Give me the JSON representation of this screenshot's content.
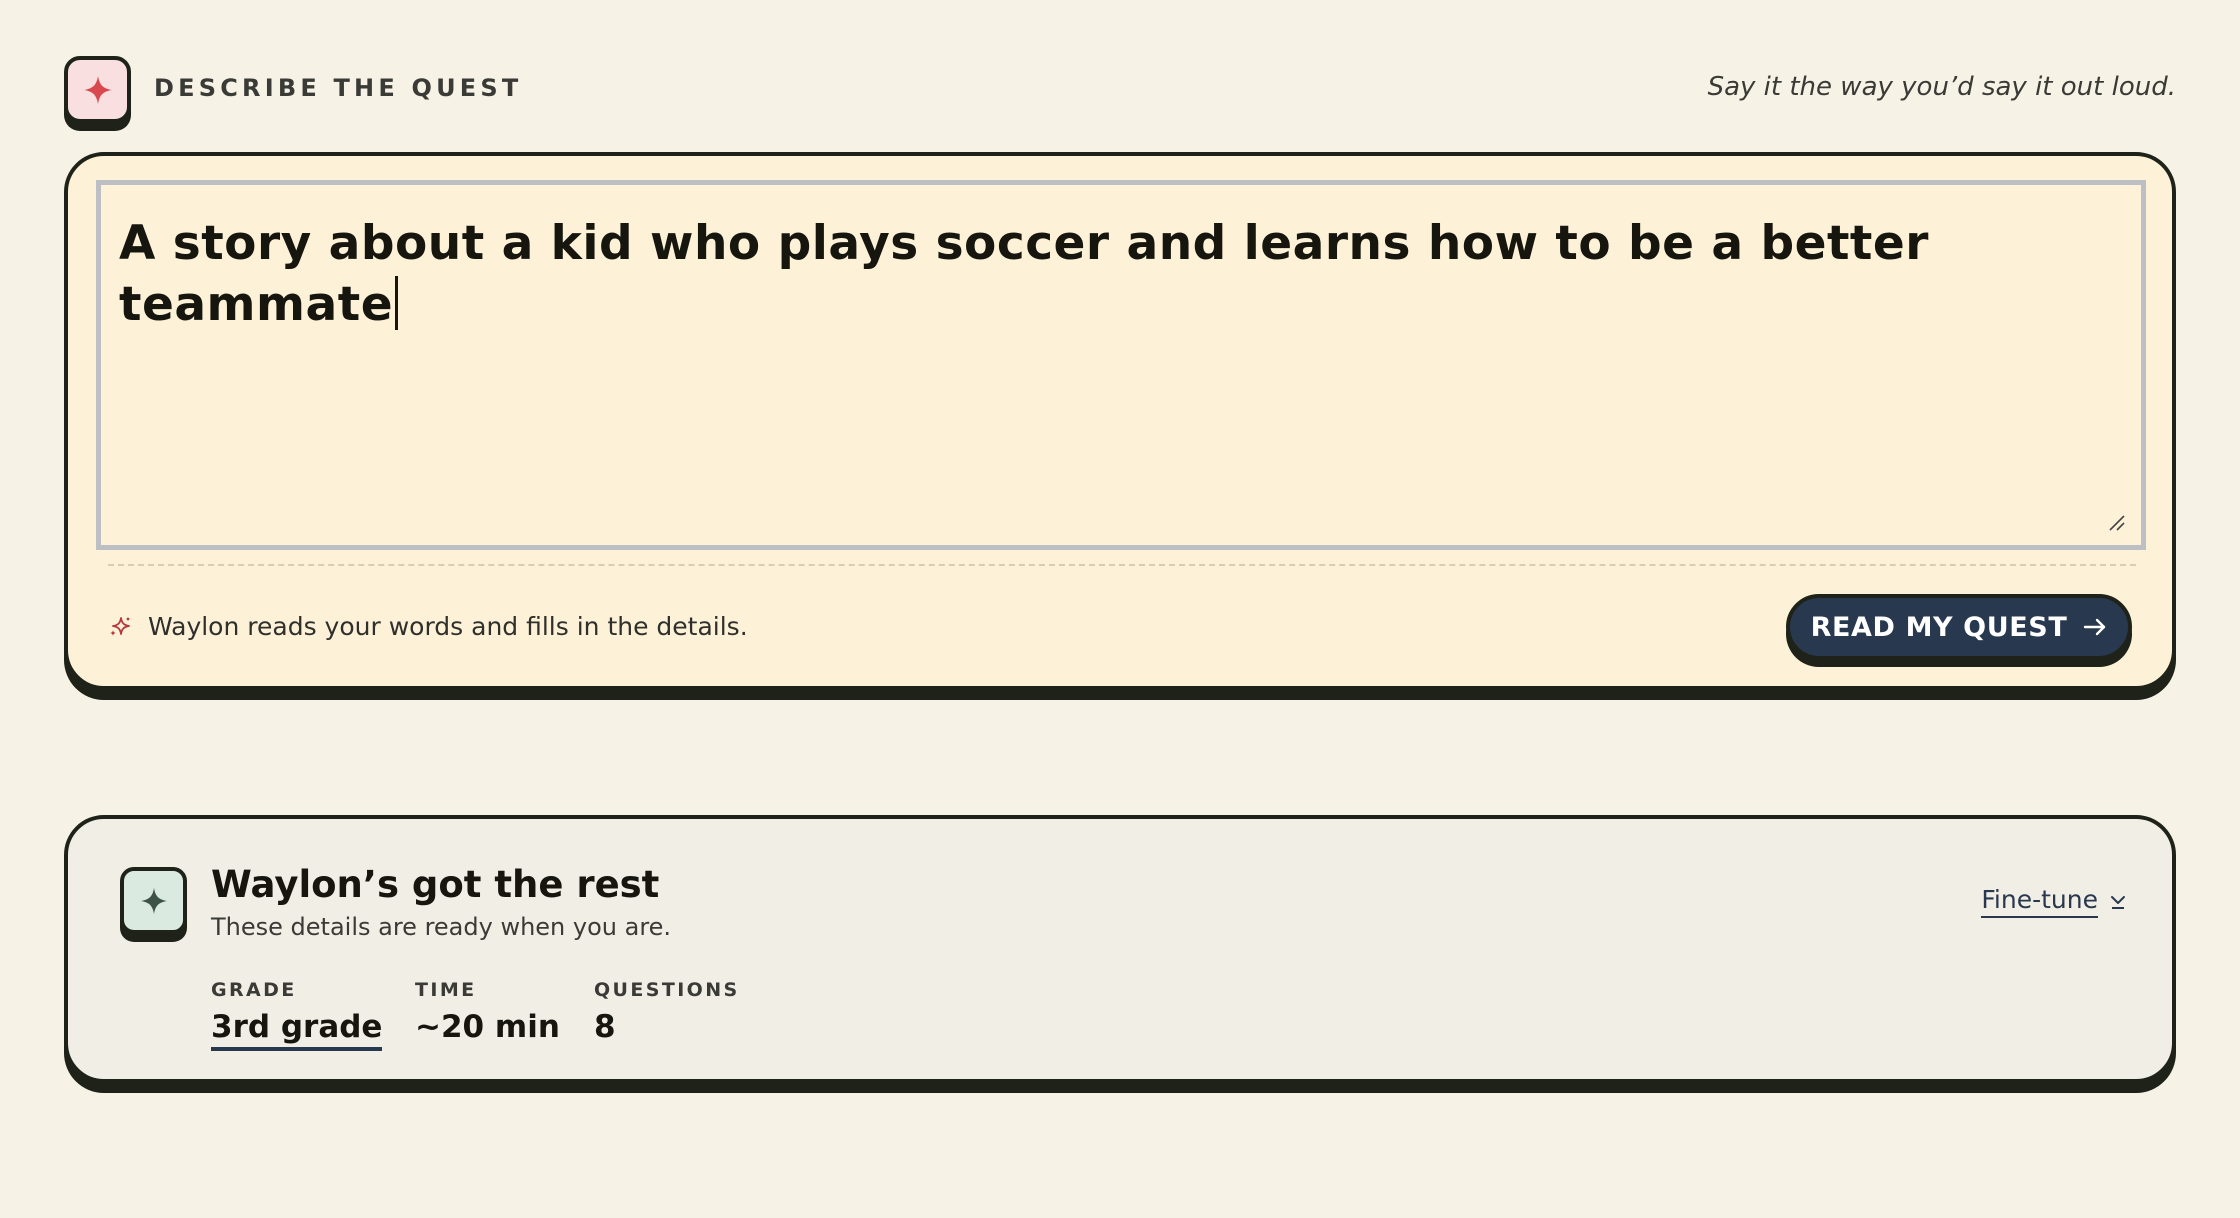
{
  "header": {
    "label": "DESCRIBE THE QUEST",
    "hint": "Say it the way you’d say it out loud.",
    "icon": "sparkle-icon",
    "icon_color": "#d9484f"
  },
  "quest": {
    "input_value": "A story about a kid who plays soccer and learns how to be a better teammate",
    "helper_text": "Waylon reads your words and fills in the details.",
    "helper_icon": "sparkles-icon",
    "button_label": "READ MY QUEST",
    "button_icon": "arrow-right-icon"
  },
  "details": {
    "title": "Waylon’s got the rest",
    "subtitle": "These details are ready when you are.",
    "icon": "sparkle-icon",
    "fine_tune_label": "Fine-tune",
    "fine_tune_icon": "chevron-down-icon",
    "stats": [
      {
        "label": "GRADE",
        "value": "3rd grade"
      },
      {
        "label": "TIME",
        "value": "~20 min"
      },
      {
        "label": "QUESTIONS",
        "value": "8"
      }
    ]
  },
  "colors": {
    "background": "#f7f2e6",
    "card_input": "#fdf2d8",
    "card_details": "#f1eee6",
    "ink": "#1e2218",
    "button": "#28384e",
    "accent_pink": "#f9dfe0",
    "accent_green": "#dbeae0"
  }
}
